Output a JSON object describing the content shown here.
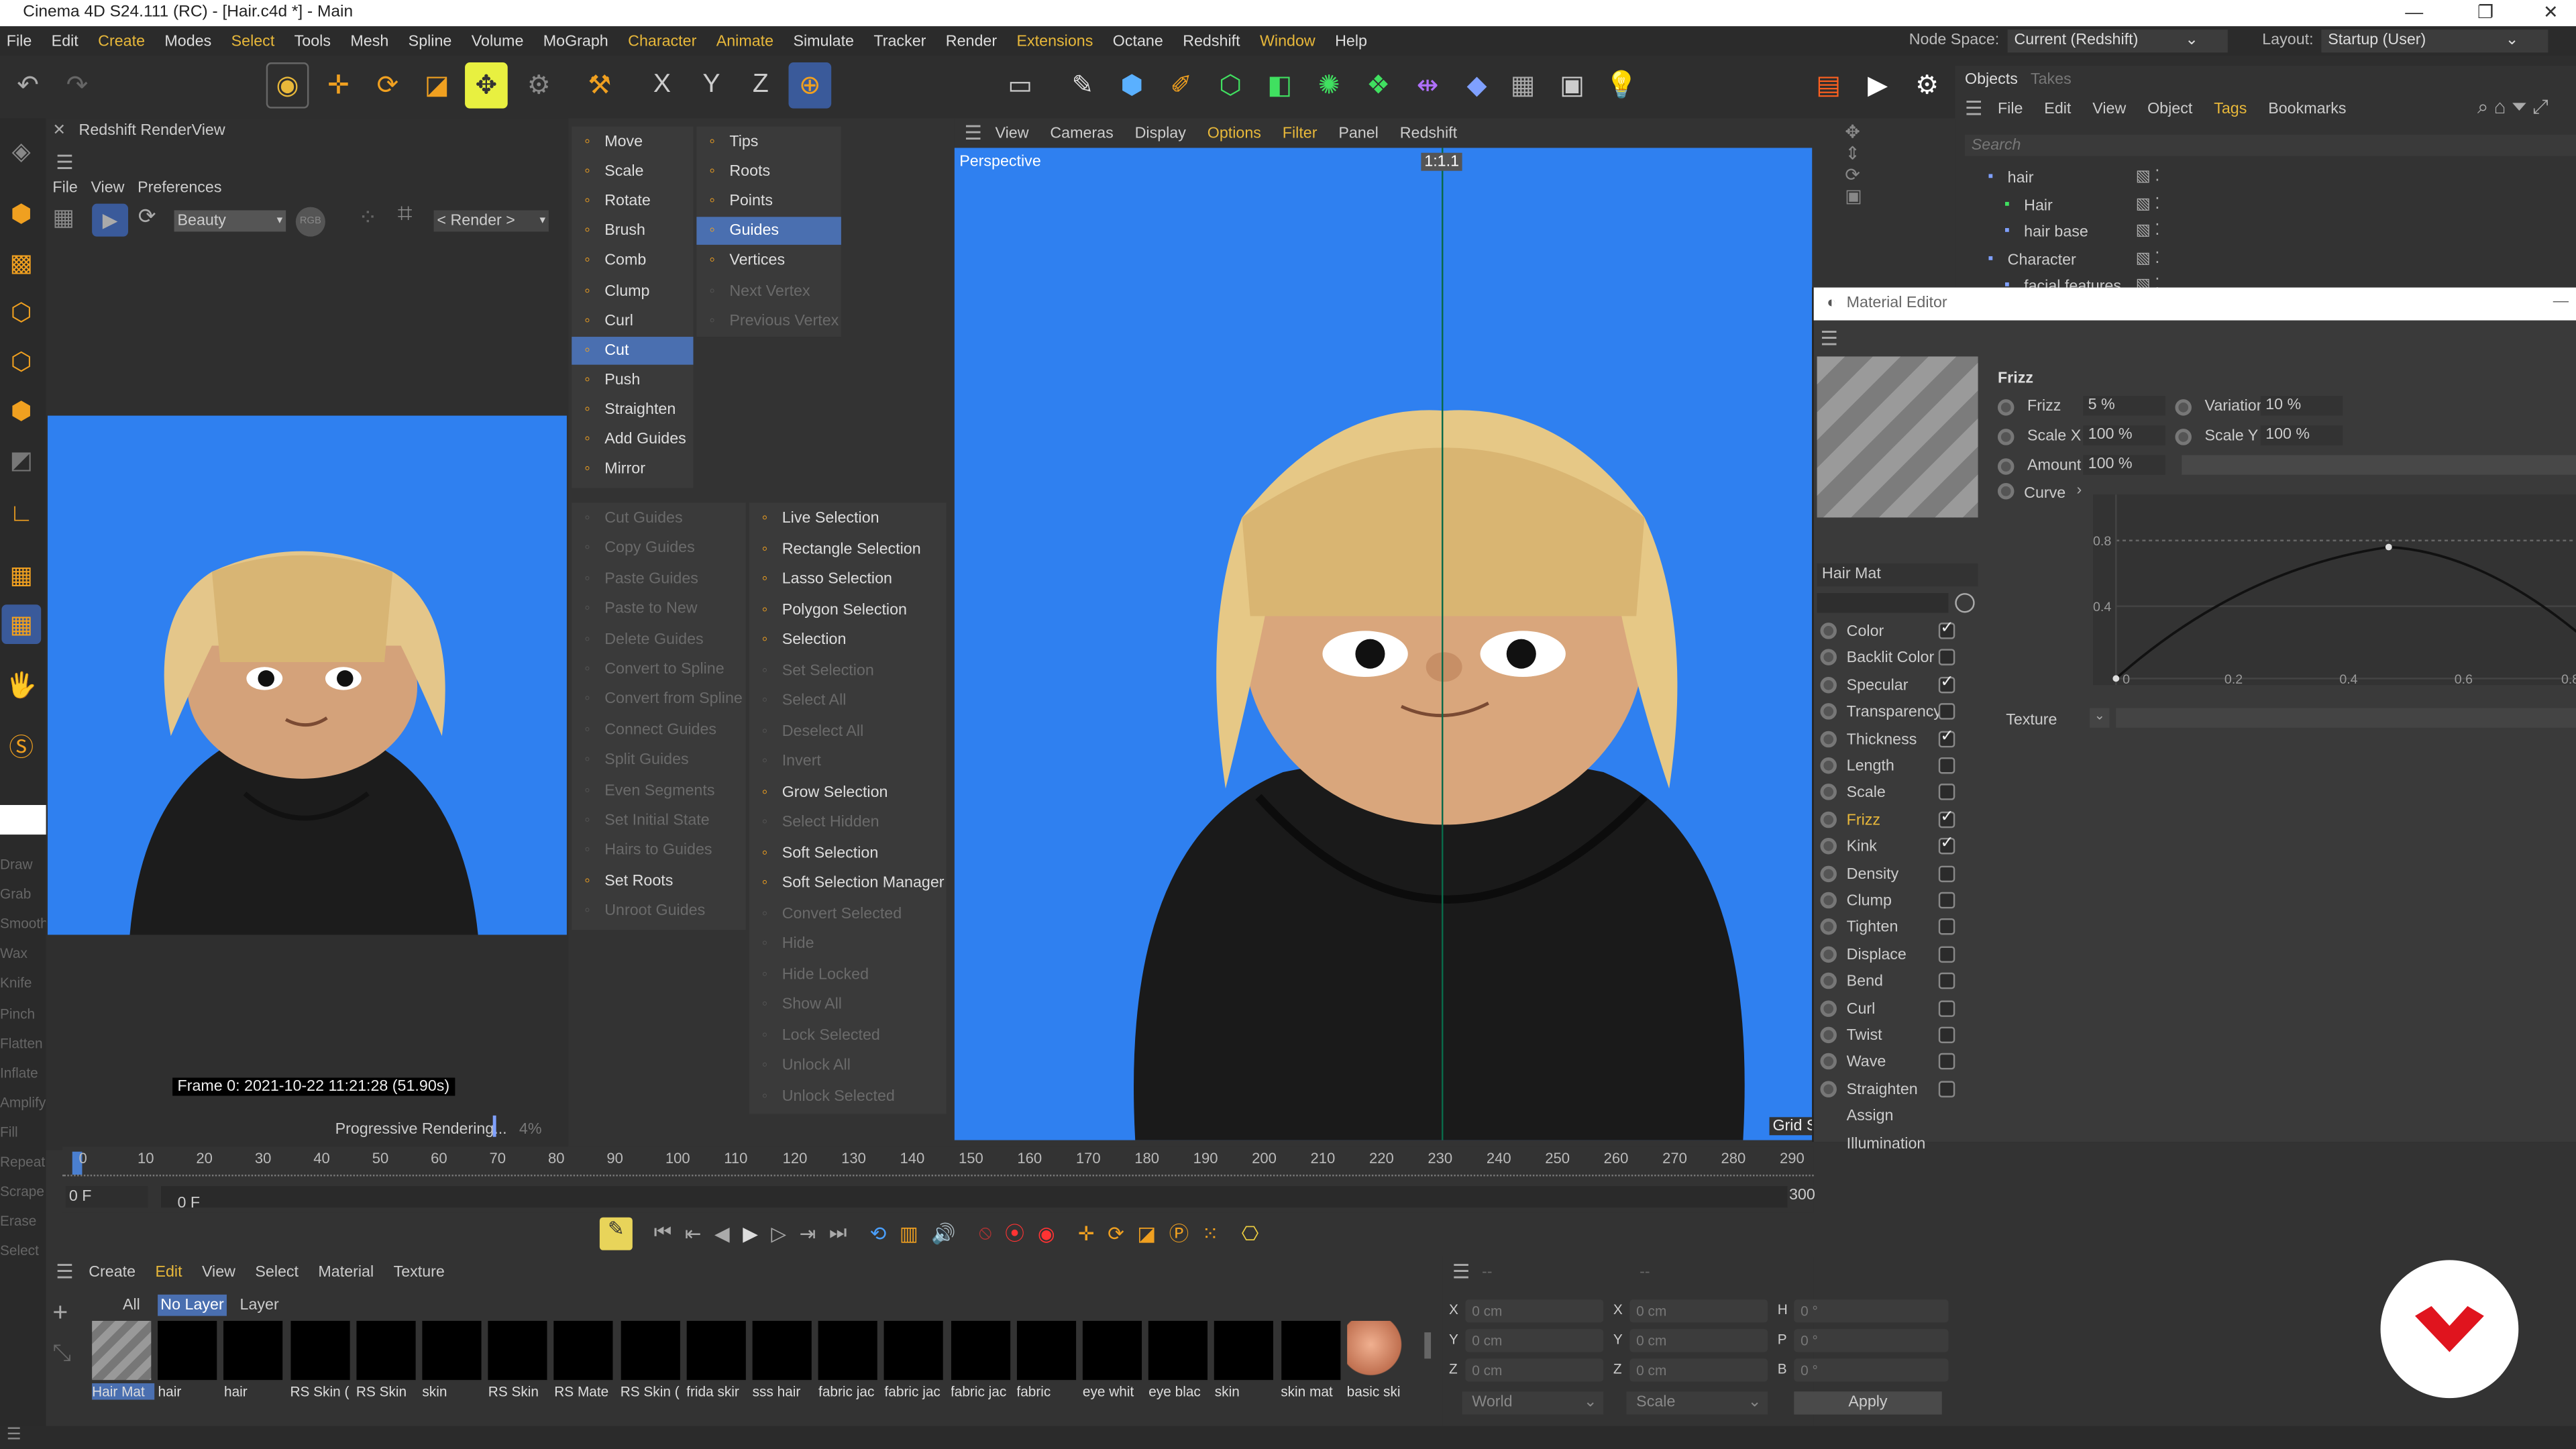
{
  "window": {
    "title": "Cinema 4D S24.111 (RC) - [Hair.c4d *] - Main"
  },
  "menubar": {
    "items": [
      "File",
      "Edit",
      "Create",
      "Modes",
      "Select",
      "Tools",
      "Mesh",
      "Spline",
      "Volume",
      "MoGraph",
      "Character",
      "Animate",
      "Simulate",
      "Tracker",
      "Render",
      "Extensions",
      "Octane",
      "Redshift",
      "Window",
      "Help"
    ],
    "node_space_label": "Node Space:",
    "node_space_value": "Current (Redshift)",
    "layout_label": "Layout:",
    "layout_value": "Startup (User)"
  },
  "renderview": {
    "title": "Redshift RenderView",
    "menu": [
      "File",
      "View",
      "Preferences"
    ],
    "aov": "Beauty",
    "rgb": "RGB",
    "render_target": "< Render >",
    "frame_info": "Frame  0:  2021-10-22  11:21:28  (51.90s)",
    "status": "Progressive Rendering...",
    "progress": "4%"
  },
  "hair_tools": {
    "col1": [
      {
        "label": "Move",
        "state": "normal",
        "icon": "move-icon"
      },
      {
        "label": "Scale",
        "state": "normal",
        "icon": "scale-icon"
      },
      {
        "label": "Rotate",
        "state": "normal",
        "icon": "rotate-icon"
      },
      {
        "label": "Brush",
        "state": "normal",
        "icon": "brush-icon"
      },
      {
        "label": "Comb",
        "state": "normal",
        "icon": "comb-icon"
      },
      {
        "label": "Clump",
        "state": "normal",
        "icon": "clump-icon"
      },
      {
        "label": "Curl",
        "state": "normal",
        "icon": "curl-icon"
      },
      {
        "label": "Cut",
        "state": "selected",
        "icon": "cut-icon"
      },
      {
        "label": "Push",
        "state": "normal",
        "icon": "push-icon"
      },
      {
        "label": "Straighten",
        "state": "normal",
        "icon": "straighten-icon"
      },
      {
        "label": "Add Guides",
        "state": "normal",
        "icon": "add-guides-icon"
      },
      {
        "label": "Mirror",
        "state": "normal",
        "icon": "mirror-icon"
      }
    ],
    "col2": [
      {
        "label": "Tips",
        "state": "normal"
      },
      {
        "label": "Roots",
        "state": "normal"
      },
      {
        "label": "Points",
        "state": "normal"
      },
      {
        "label": "Guides",
        "state": "selected"
      },
      {
        "label": "Vertices",
        "state": "normal"
      },
      {
        "label": "Next Vertex",
        "state": "disabled"
      },
      {
        "label": "Previous Vertex",
        "state": "disabled"
      }
    ],
    "col3": [
      {
        "label": "Cut Guides",
        "state": "disabled"
      },
      {
        "label": "Copy Guides",
        "state": "disabled"
      },
      {
        "label": "Paste Guides",
        "state": "disabled"
      },
      {
        "label": "Paste to New",
        "state": "disabled"
      },
      {
        "label": "Delete Guides",
        "state": "disabled"
      },
      {
        "label": "Convert to Spline",
        "state": "disabled"
      },
      {
        "label": "Convert from Spline",
        "state": "disabled"
      },
      {
        "label": "Connect Guides",
        "state": "disabled"
      },
      {
        "label": "Split Guides",
        "state": "disabled"
      },
      {
        "label": "Even Segments",
        "state": "disabled"
      },
      {
        "label": "Set Initial State",
        "state": "disabled"
      },
      {
        "label": "Hairs to Guides",
        "state": "disabled"
      },
      {
        "label": "Set Roots",
        "state": "normal"
      },
      {
        "label": "Unroot Guides",
        "state": "disabled"
      }
    ],
    "col4": [
      {
        "label": "Live Selection",
        "state": "normal"
      },
      {
        "label": "Rectangle Selection",
        "state": "normal"
      },
      {
        "label": "Lasso Selection",
        "state": "normal"
      },
      {
        "label": "Polygon Selection",
        "state": "normal"
      },
      {
        "label": "Selection",
        "state": "normal"
      },
      {
        "label": "Set Selection",
        "state": "disabled"
      },
      {
        "label": "Select All",
        "state": "disabled"
      },
      {
        "label": "Deselect All",
        "state": "disabled"
      },
      {
        "label": "Invert",
        "state": "disabled"
      },
      {
        "label": "Grow Selection",
        "state": "normal"
      },
      {
        "label": "Select Hidden",
        "state": "disabled"
      },
      {
        "label": "Soft Selection",
        "state": "normal"
      },
      {
        "label": "Soft Selection Manager",
        "state": "normal"
      },
      {
        "label": "Convert Selected",
        "state": "disabled"
      },
      {
        "label": "Hide",
        "state": "disabled"
      },
      {
        "label": "Hide Locked",
        "state": "disabled"
      },
      {
        "label": "Show All",
        "state": "disabled"
      },
      {
        "label": "Lock Selected",
        "state": "disabled"
      },
      {
        "label": "Unlock All",
        "state": "disabled"
      },
      {
        "label": "Unlock Selected",
        "state": "disabled"
      }
    ]
  },
  "viewport": {
    "menu": [
      "View",
      "Cameras",
      "Display",
      "Options",
      "Filter",
      "Panel",
      "Redshift"
    ],
    "camera": "Perspective",
    "ratio": "1:1.1",
    "grid": "Grid S"
  },
  "left_sculpt": [
    "Draw",
    "Grab",
    "Smooth",
    "Wax",
    "Knife",
    "Pinch",
    "Flatten",
    "Inflate",
    "Amplify",
    "Fill",
    "Repeat",
    "Scrape",
    "Erase",
    "Select"
  ],
  "objects": {
    "tabs": [
      "Objects",
      "Takes"
    ],
    "menu": [
      "File",
      "Edit",
      "View",
      "Object",
      "Tags",
      "Bookmarks"
    ],
    "search_placeholder": "Search",
    "tree": [
      "hair",
      "Hair",
      "hair base",
      "Character",
      "facial features"
    ]
  },
  "material_editor": {
    "title": "Material Editor",
    "mat_name": "Hair Mat",
    "section": "Frizz",
    "params": [
      {
        "label": "Frizz",
        "value": "5 %"
      },
      {
        "label": "Variation",
        "value": "10 %"
      },
      {
        "label": "Scale X",
        "value": "100 %"
      },
      {
        "label": "Scale Y",
        "value": "100 %"
      },
      {
        "label": "Amount",
        "value": "100 %"
      }
    ],
    "curve_label": "Curve",
    "texture_label": "Texture",
    "curve_y_ticks": [
      "0.8",
      "0.4",
      "0"
    ],
    "curve_x_ticks": [
      "0.2",
      "0.4",
      "0.6",
      "0.8"
    ],
    "channels": [
      {
        "label": "Color",
        "on": true
      },
      {
        "label": "Backlit Color",
        "on": false
      },
      {
        "label": "Specular",
        "on": true
      },
      {
        "label": "Transparency",
        "on": false
      },
      {
        "label": "Thickness",
        "on": true
      },
      {
        "label": "Length",
        "on": false
      },
      {
        "label": "Scale",
        "on": false
      },
      {
        "label": "Frizz",
        "on": true,
        "active": true
      },
      {
        "label": "Kink",
        "on": true
      },
      {
        "label": "Density",
        "on": false
      },
      {
        "label": "Clump",
        "on": false
      },
      {
        "label": "Tighten",
        "on": false
      },
      {
        "label": "Displace",
        "on": false
      },
      {
        "label": "Bend",
        "on": false
      },
      {
        "label": "Curl",
        "on": false
      },
      {
        "label": "Twist",
        "on": false
      },
      {
        "label": "Wave",
        "on": false
      },
      {
        "label": "Straighten",
        "on": false
      },
      {
        "label": "Assign",
        "on": null
      },
      {
        "label": "Illumination",
        "on": null
      }
    ]
  },
  "timeline": {
    "ticks": [
      "0",
      "10",
      "20",
      "30",
      "40",
      "50",
      "60",
      "70",
      "80",
      "90",
      "100",
      "110",
      "120",
      "130",
      "140",
      "150",
      "160",
      "170",
      "180",
      "190",
      "200",
      "210",
      "220",
      "230",
      "240",
      "250",
      "260",
      "270",
      "280",
      "290"
    ],
    "current_frame": "0 F",
    "start": "0 F",
    "end": "300"
  },
  "material_manager": {
    "menu": [
      "Create",
      "Edit",
      "View",
      "Select",
      "Material",
      "Texture"
    ],
    "filters": [
      "All",
      "No Layer",
      "Layer"
    ],
    "materials": [
      "Hair Mat",
      "hair",
      "hair",
      "RS Skin (",
      "RS Skin",
      "skin",
      "RS Skin",
      "RS Mate",
      "RS Skin (",
      "frida skir",
      "sss hair",
      "fabric jac",
      "fabric jac",
      "fabric jac",
      "fabric",
      "eye whit",
      "eye blac",
      "skin",
      "skin mat",
      "basic ski"
    ]
  },
  "coordinates": {
    "rows": [
      {
        "a": "X",
        "av": "0 cm",
        "b": "X",
        "bv": "0 cm",
        "c": "H",
        "cv": "0 °"
      },
      {
        "a": "Y",
        "av": "0 cm",
        "b": "Y",
        "bv": "0 cm",
        "c": "P",
        "cv": "0 °"
      },
      {
        "a": "Z",
        "av": "0 cm",
        "b": "Z",
        "bv": "0 cm",
        "c": "B",
        "cv": "0 °"
      }
    ],
    "mode": "World",
    "mode2": "Scale",
    "apply": "Apply"
  },
  "colors": {
    "accent": "#e8b83a",
    "selection": "#4a6fb0",
    "viewport_bg": "#2f80f0",
    "brand": "#e0141e"
  }
}
